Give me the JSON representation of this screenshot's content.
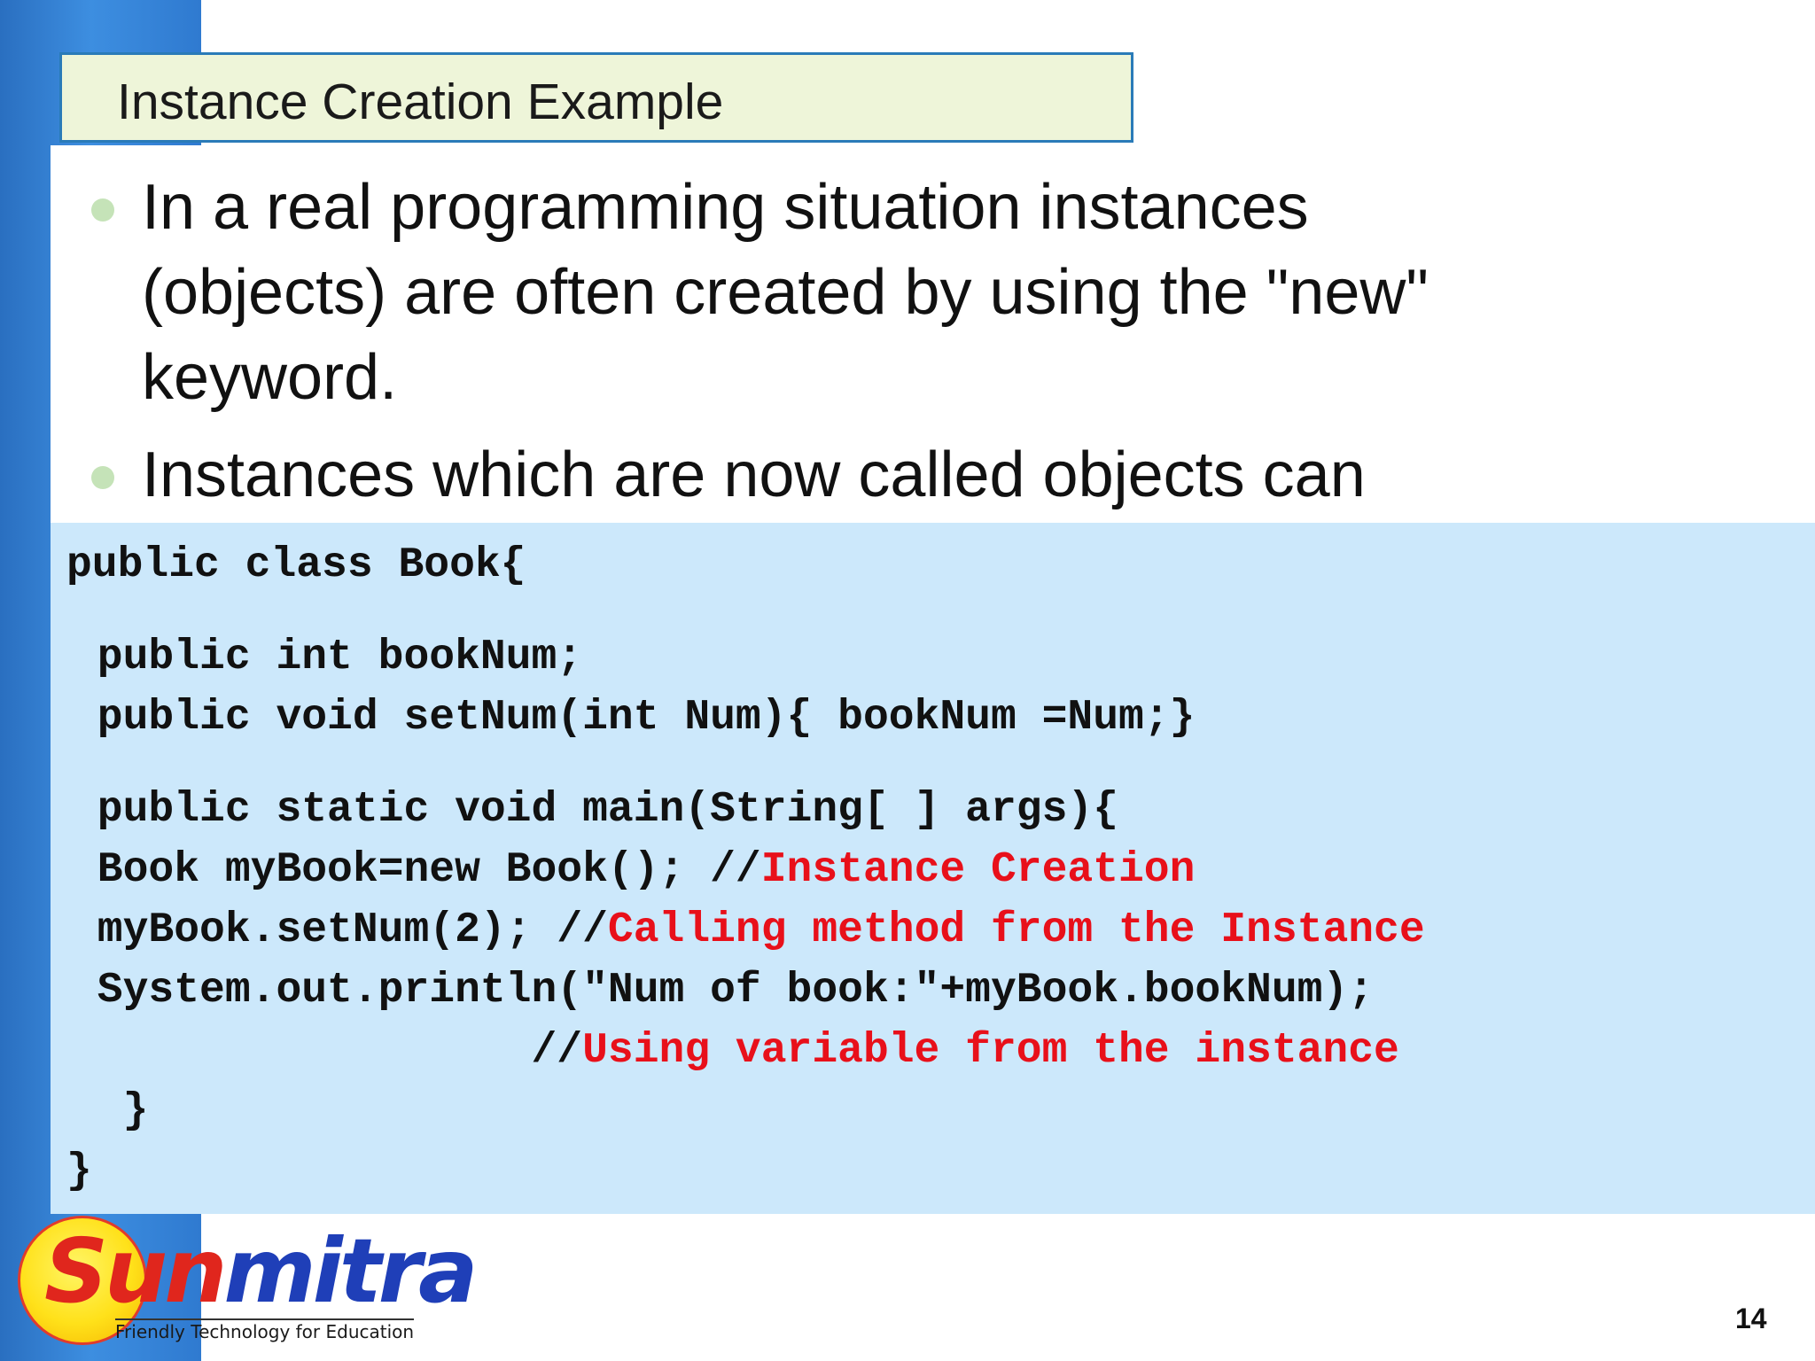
{
  "slide": {
    "title": "Instance Creation Example",
    "bullets": [
      {
        "lines": [
          "In a real programming situation instances",
          "(objects) are often created by using the \"new\"",
          "keyword."
        ]
      },
      {
        "lines": [
          "Instances which are now called objects can"
        ]
      }
    ],
    "code": {
      "line1": "public class Book{",
      "line2": " public int bookNum;",
      "line3": " public void setNum(int Num){ bookNum =Num;}",
      "line4": " public static void main(String[ ] args){",
      "line5_code": " Book myBook=new Book(); //",
      "line5_comment": "Instance Creation",
      "line6_code": " myBook.setNum(2); //",
      "line6_comment": "Calling method from the Instance",
      "line7": " System.out.println(\"Num of book:\"+myBook.bookNum);",
      "line8_code": "                  //",
      "line8_comment": "Using variable from the instance",
      "line9": "  }",
      "line10": "}"
    },
    "logo": {
      "word_part_a": "Sun",
      "word_part_b": "mitra",
      "tagline": "Friendly Technology for Education"
    },
    "page_number": "14"
  },
  "colors": {
    "left_bar": "#2f7ad0",
    "title_bg": "#eef5d9",
    "title_border": "#2a7bb8",
    "code_bg": "#cce8fb",
    "comment": "#e8101a",
    "bullet": "#c5e3b8"
  }
}
